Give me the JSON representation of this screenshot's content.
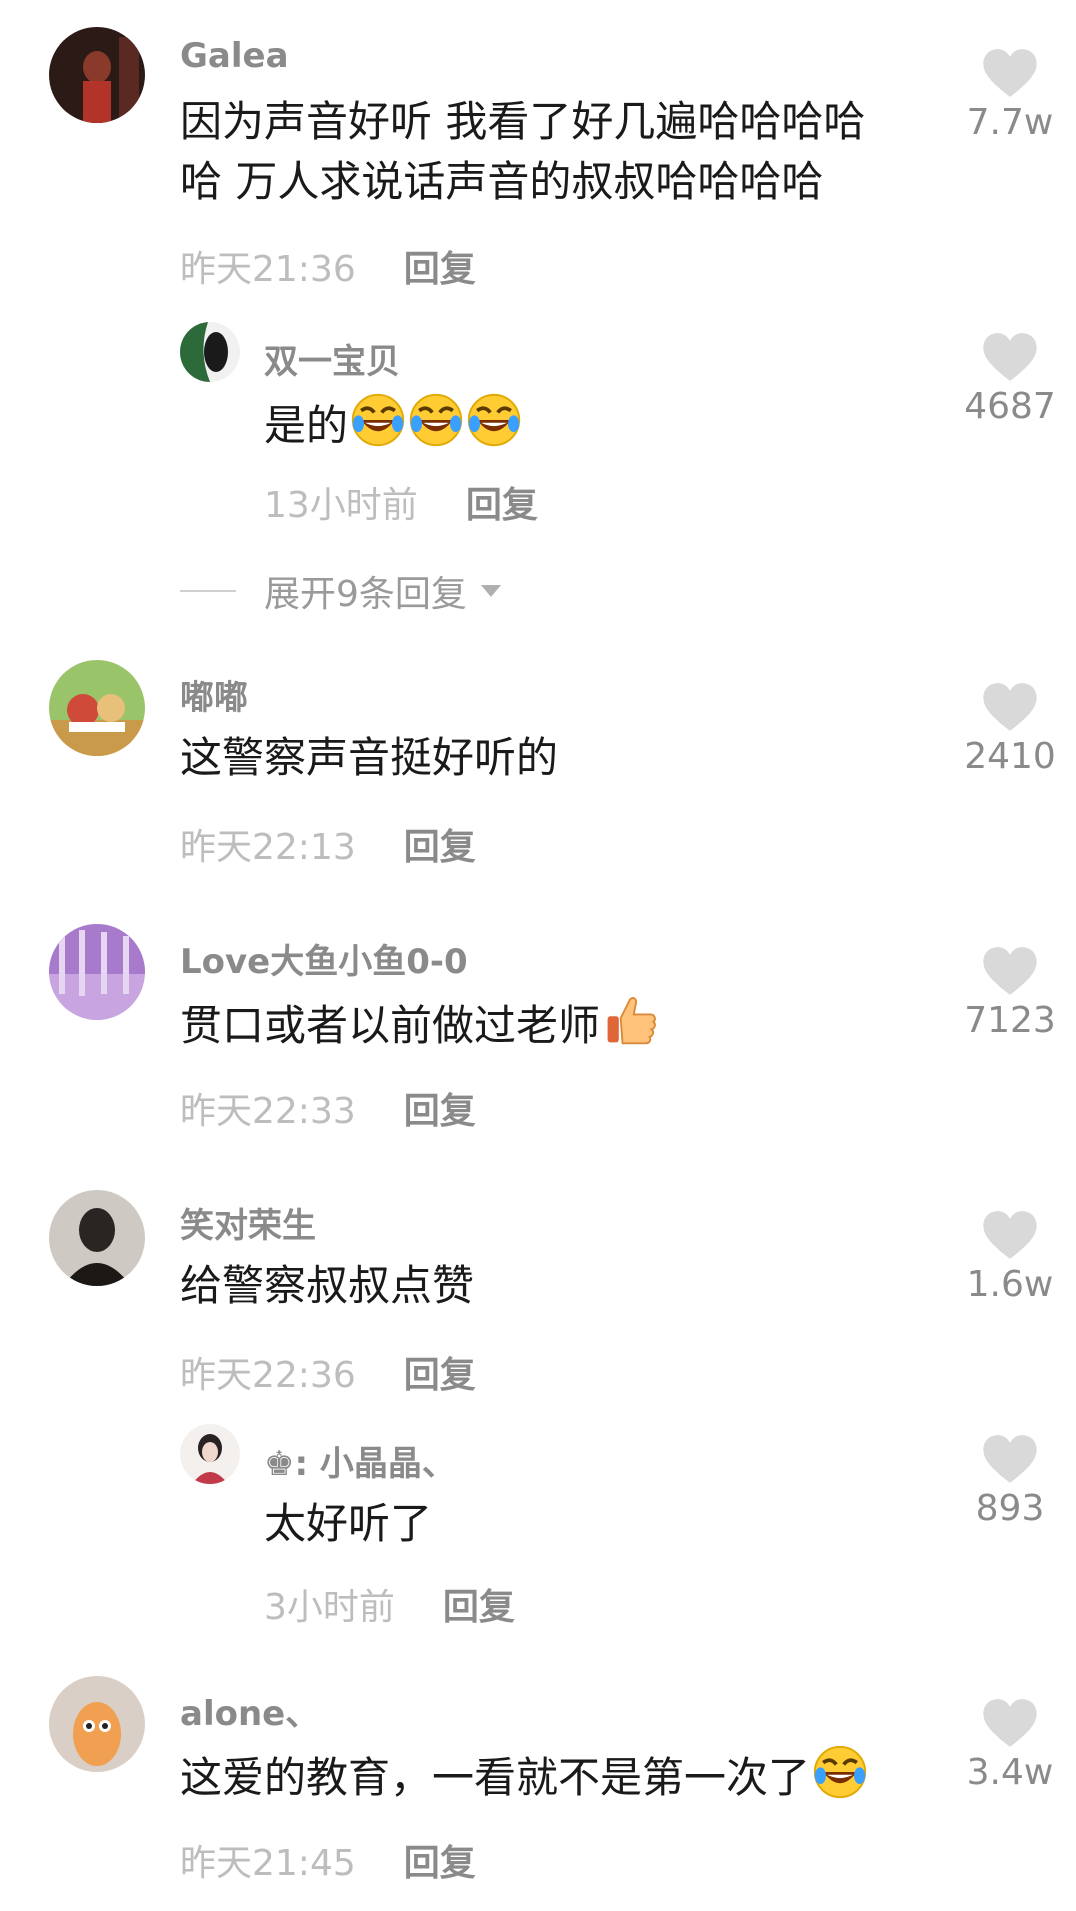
{
  "comments": [
    {
      "user": "Galea",
      "lines": [
        "因为声音好听 我看了好几遍哈哈哈哈",
        "哈 万人求说话声音的叔叔哈哈哈哈"
      ],
      "time": "昨天21:36",
      "reply": "回复",
      "likes": "7.7w"
    },
    {
      "user": "双一宝贝",
      "text": "是的",
      "emoji": "rofl-emoji",
      "time": "13小时前",
      "reply": "回复",
      "likes": "4687"
    },
    {
      "user": "嘟嘟",
      "text": "这警察声音挺好听的",
      "time": "昨天22:13",
      "reply": "回复",
      "likes": "2410"
    },
    {
      "user": "Love大鱼小鱼0-0",
      "text": "贯口或者以前做过老师",
      "emoji": "thumbs-up-emoji",
      "time": "昨天22:33",
      "reply": "回复",
      "likes": "7123"
    },
    {
      "user": "笑对荣生",
      "text": "给警察叔叔点赞",
      "time": "昨天22:36",
      "reply": "回复",
      "likes": "1.6w"
    },
    {
      "user": "♚: 小晶晶、",
      "text": "太好听了",
      "time": "3小时前",
      "reply": "回复",
      "likes": "893"
    },
    {
      "user": "alone、",
      "text": "这爱的教育，一看就不是第一次了",
      "emoji": "rofl-emoji",
      "time": "昨天21:45",
      "reply": "回复",
      "likes": "3.4w"
    }
  ],
  "expand_replies": "展开9条回复",
  "colors": {
    "username": "#8a8a8a",
    "time": "#bdbdbd",
    "heart": "#d9d9d9"
  }
}
